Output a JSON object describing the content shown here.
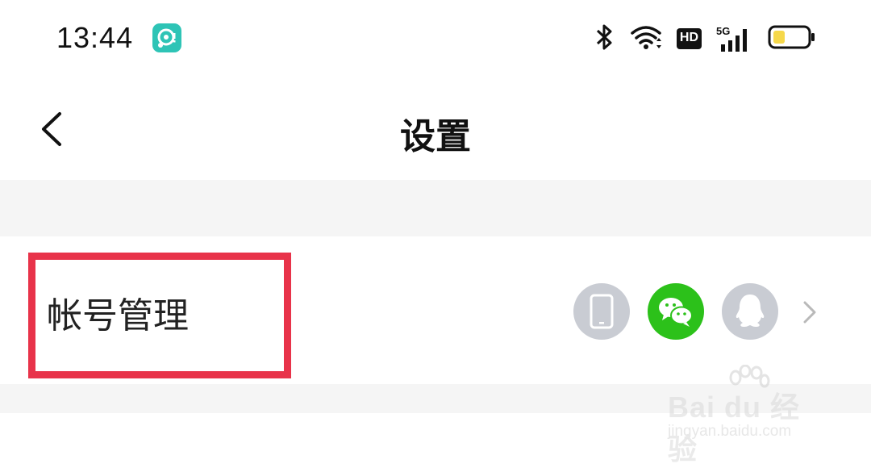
{
  "status_bar": {
    "time": "13:44",
    "network": "5G",
    "hd_label": "HD"
  },
  "nav": {
    "title": "设置"
  },
  "account_row": {
    "label": "帐号管理",
    "bound_accounts": [
      "phone-icon",
      "wechat-icon",
      "qq-icon"
    ]
  },
  "colors": {
    "highlight": "#e8334a",
    "wechat_green": "#2cc11a",
    "inactive_gray": "#c9ccd3",
    "section_gap": "#f5f5f5"
  },
  "watermark": {
    "main": "Bai du 经验",
    "url": "jingyan.baidu.com"
  }
}
